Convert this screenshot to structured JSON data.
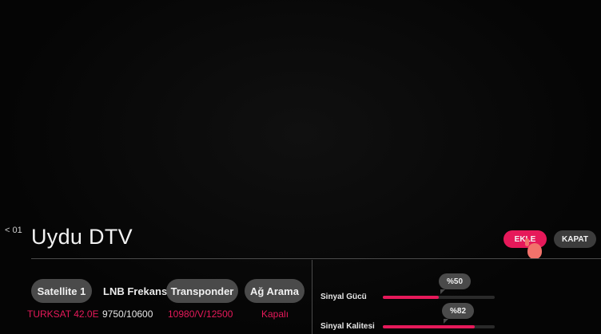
{
  "header": {
    "step": "< 01",
    "title": "Uydu DTV"
  },
  "actions": {
    "add_label": "EKLE",
    "close_label": "KAPAT"
  },
  "settings": {
    "satellite": {
      "label": "Satellite 1",
      "value": "TURKSAT 42.0E"
    },
    "lnb": {
      "label": "LNB Frekansı",
      "value": "9750/10600"
    },
    "transponder": {
      "label": "Transponder",
      "value": "10980/V/12500"
    },
    "network_search": {
      "label": "Ağ Arama",
      "value": "Kapalı"
    }
  },
  "signal": {
    "strength": {
      "label": "Sinyal Gücü",
      "value_text": "%50",
      "percent": 50
    },
    "quality": {
      "label": "Sinyal Kalitesi",
      "value_text": "%82",
      "percent": 82
    }
  },
  "colors": {
    "accent": "#e6195a",
    "chip_bg": "#4a4a4a",
    "background": "#050505"
  }
}
